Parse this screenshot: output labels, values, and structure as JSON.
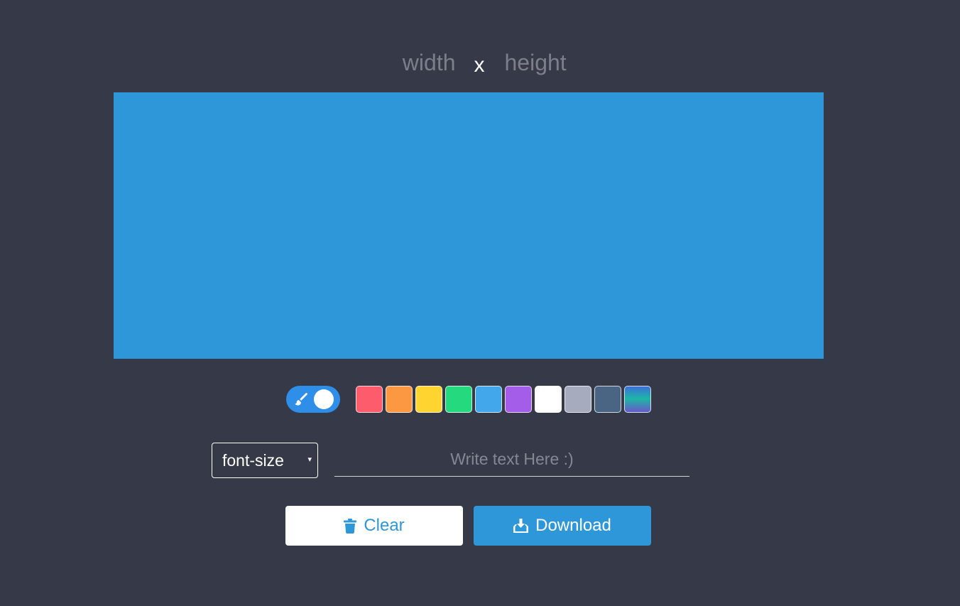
{
  "dimensions": {
    "width_placeholder": "width",
    "separator": "x",
    "height_placeholder": "height"
  },
  "canvas": {
    "color": "#2e97da"
  },
  "toggle": {
    "icon": "paintbrush-icon",
    "state": "on",
    "color": "#2e8ee8"
  },
  "palette": [
    {
      "name": "red",
      "color": "#fc5c6c"
    },
    {
      "name": "orange",
      "color": "#fd9842"
    },
    {
      "name": "yellow",
      "color": "#fed530"
    },
    {
      "name": "green",
      "color": "#25d97f"
    },
    {
      "name": "sky-blue",
      "color": "#43a8eb"
    },
    {
      "name": "purple",
      "color": "#a35de8"
    },
    {
      "name": "white",
      "color": "#ffffff"
    },
    {
      "name": "gray",
      "color": "#a6acbe"
    },
    {
      "name": "slate",
      "color": "#4a6584"
    },
    {
      "name": "gradient",
      "color": "linear-gradient(180deg, #3c6fd8 0%, #1db6a6 48%, #6a58c8 100%)"
    }
  ],
  "font_size_select": {
    "label": "font-size",
    "arrow": "▾"
  },
  "text_input": {
    "placeholder": "Write text Here :)"
  },
  "buttons": {
    "clear": {
      "label": "Clear",
      "icon": "trash-icon",
      "color": "#2e97da"
    },
    "download": {
      "label": "Download",
      "icon": "download-icon",
      "color": "#2e97da"
    }
  }
}
